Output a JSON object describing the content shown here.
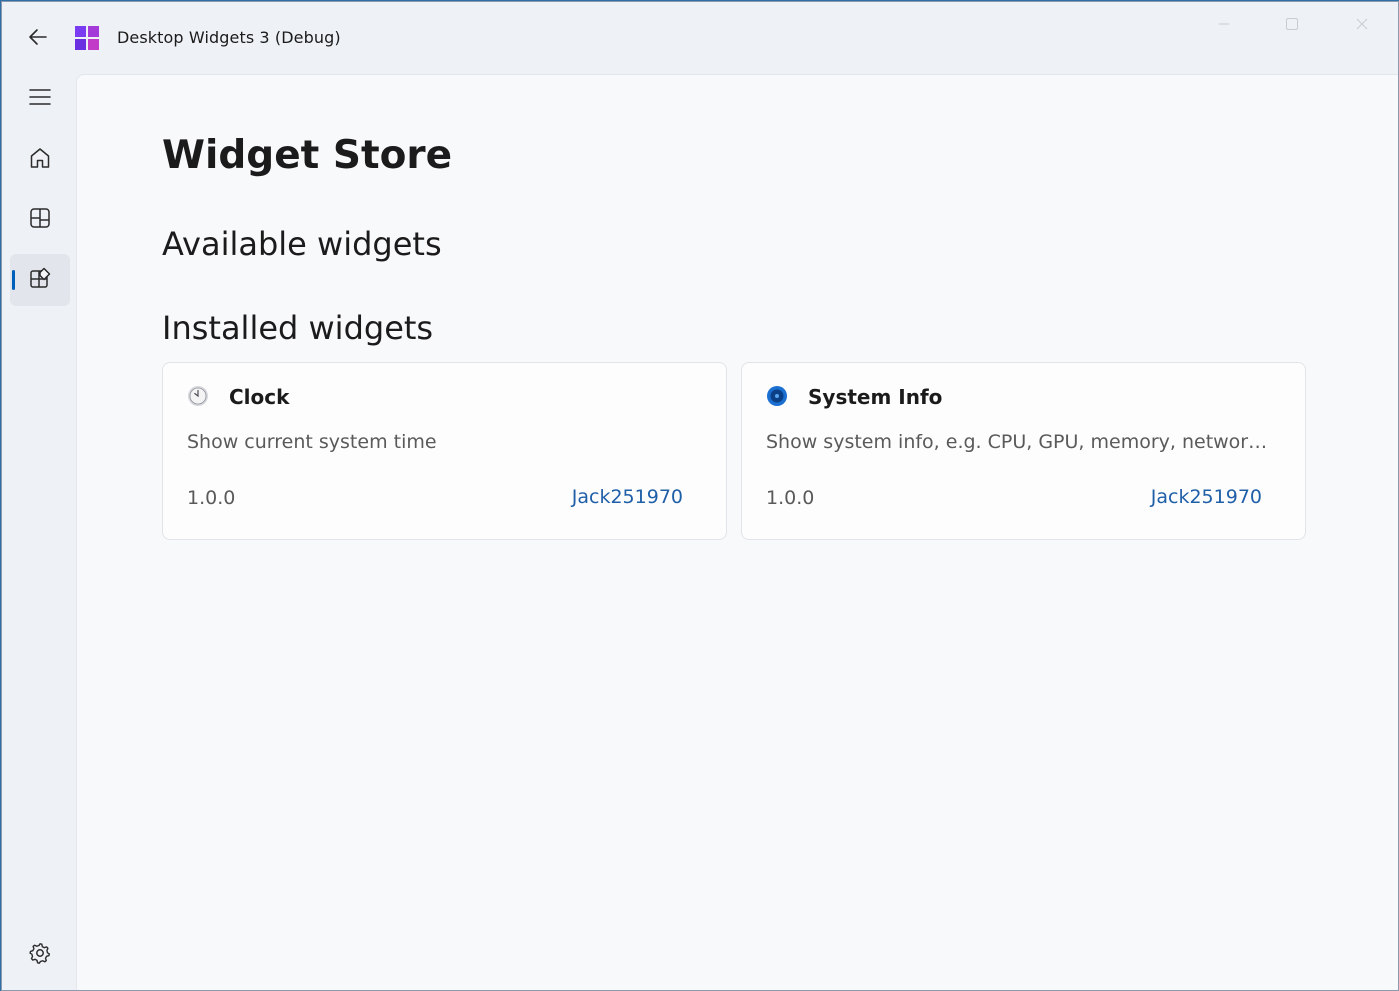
{
  "window": {
    "title": "Desktop Widgets 3 (Debug)",
    "accent_color": "#005fb8"
  },
  "titlebar": {
    "back_icon": "back-arrow-icon",
    "logo_icon": "app-logo-icon",
    "caption_buttons": [
      "minimize-icon",
      "maximize-icon",
      "close-icon"
    ]
  },
  "nav": {
    "items": [
      {
        "icon": "hamburger-menu-icon",
        "selected": false
      },
      {
        "icon": "home-icon",
        "selected": false
      },
      {
        "icon": "dashboard-icon",
        "selected": false
      },
      {
        "icon": "widget-store-icon",
        "selected": true
      },
      {
        "icon": "gear-icon",
        "selected": false
      }
    ]
  },
  "page": {
    "title": "Widget Store",
    "available_header": "Available widgets",
    "installed_header": "Installed widgets"
  },
  "installed_widgets": [
    {
      "name": "Clock",
      "description": "Show current system time",
      "version": "1.0.0",
      "author": "Jack251970",
      "icon": "clock-icon"
    },
    {
      "name": "System Info",
      "description": "Show system info, e.g. CPU, GPU, memory, network a...",
      "version": "1.0.0",
      "author": "Jack251970",
      "icon": "system-info-icon"
    }
  ]
}
